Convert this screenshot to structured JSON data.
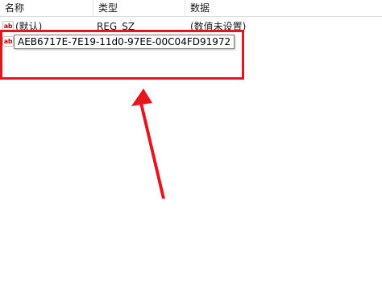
{
  "columns": {
    "name": "名称",
    "type": "类型",
    "data": "数据"
  },
  "rows": [
    {
      "icon": "ab",
      "name": "(默认)",
      "type": "REG_SZ",
      "data": "(数值未设置)"
    }
  ],
  "editing_row": {
    "icon": "ab",
    "value": "AEB6717E-7E19-11d0-97EE-00C04FD91972"
  },
  "annotation": {
    "highlight_color": "#e8141b",
    "arrow_color": "#e8141b"
  }
}
